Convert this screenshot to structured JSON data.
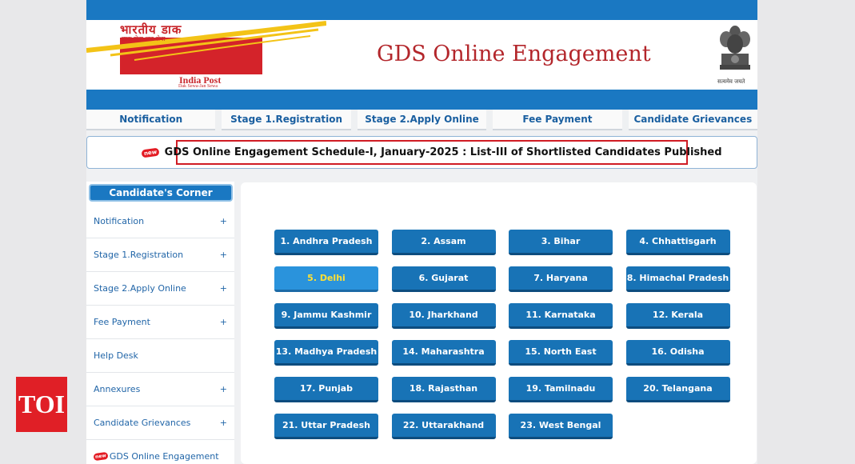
{
  "header": {
    "logo_hindi": "भारतीय डाक",
    "logo_hindi_sub": "डाक सेवा-जन सेवा",
    "logo_text": "India Post",
    "logo_subtext": "Dak Sewa-Jan Sewa",
    "title": "GDS Online Engagement",
    "emblem_caption": "सत्यमेव जयते"
  },
  "nav": {
    "items": [
      "Notification",
      "Stage 1.Registration",
      "Stage 2.Apply Online",
      "Fee Payment",
      "Candidate Grievances"
    ]
  },
  "announcement": {
    "badge": "new",
    "text": "GDS Online Engagement Schedule-I, January-2025 : List-III of Shortlisted Candidates Published"
  },
  "sidebar": {
    "title": "Candidate's Corner",
    "items": [
      {
        "label": "Notification",
        "expand": "+"
      },
      {
        "label": "Stage 1.Registration",
        "expand": "+"
      },
      {
        "label": "Stage 2.Apply Online",
        "expand": "+"
      },
      {
        "label": "Fee Payment",
        "expand": "+"
      },
      {
        "label": "Help Desk",
        "expand": ""
      },
      {
        "label": "Annexures",
        "expand": "+"
      },
      {
        "label": "Candidate Grievances",
        "expand": "+"
      }
    ],
    "last_item": {
      "badge": "new",
      "label": "GDS Online Engagement"
    }
  },
  "states": [
    "1. Andhra Pradesh",
    "2. Assam",
    "3. Bihar",
    "4. Chhattisgarh",
    "5. Delhi",
    "6. Gujarat",
    "7. Haryana",
    "8. Himachal Pradesh",
    "9. Jammu Kashmir",
    "10. Jharkhand",
    "11. Karnataka",
    "12. Kerala",
    "13. Madhya Pradesh",
    "14. Maharashtra",
    "15. North East",
    "16. Odisha",
    "17. Punjab",
    "18. Rajasthan",
    "19. Tamilnadu",
    "20. Telangana",
    "21. Uttar Pradesh",
    "22. Uttarakhand",
    "23. West Bengal"
  ],
  "active_state": "5. Delhi",
  "watermark": "TOI",
  "colors": {
    "brand_blue": "#1a78c2",
    "button_blue": "#1873b6",
    "active_text": "#ffe033",
    "title_red": "#b3262b",
    "announce_border": "#d01c24",
    "toi_red": "#e01f26"
  }
}
